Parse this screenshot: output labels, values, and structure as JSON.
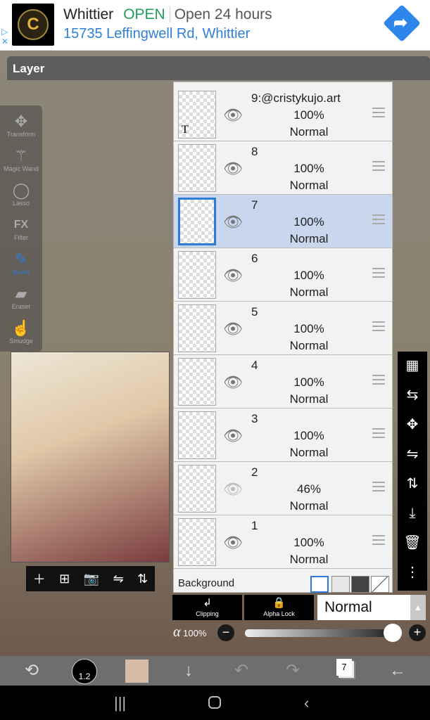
{
  "ad": {
    "business": "Whittier",
    "status": "OPEN",
    "hours": "Open 24 hours",
    "address": "15735 Leffingwell Rd, Whittier",
    "logo_letter": "C",
    "adchoices_icon": "ad-choices-icon",
    "close_icon": "close-icon"
  },
  "layer_panel": {
    "title": "Layer",
    "layers": [
      {
        "name": "9:@cristykujo.art",
        "opacity": "100%",
        "mode": "Normal",
        "visible": true,
        "text_layer_mark": "T"
      },
      {
        "name": "8",
        "opacity": "100%",
        "mode": "Normal",
        "visible": true
      },
      {
        "name": "7",
        "opacity": "100%",
        "mode": "Normal",
        "visible": true,
        "selected": true
      },
      {
        "name": "6",
        "opacity": "100%",
        "mode": "Normal",
        "visible": true
      },
      {
        "name": "5",
        "opacity": "100%",
        "mode": "Normal",
        "visible": true
      },
      {
        "name": "4",
        "opacity": "100%",
        "mode": "Normal",
        "visible": true
      },
      {
        "name": "3",
        "opacity": "100%",
        "mode": "Normal",
        "visible": true
      },
      {
        "name": "2",
        "opacity": "46%",
        "mode": "Normal",
        "visible": false
      },
      {
        "name": "1",
        "opacity": "100%",
        "mode": "Normal",
        "visible": true
      }
    ],
    "background_label": "Background",
    "clipping": "Clipping",
    "alpha_lock": "Alpha Lock",
    "blend_mode": "Normal",
    "alpha_symbol": "α",
    "opacity": "100%",
    "opacity_value": 100
  },
  "tools": [
    "Transform",
    "Magic Wand",
    "Lasso",
    "Filter",
    "Brush",
    "Eraser",
    "Smudge"
  ],
  "active_tool": "Brush",
  "accent": "#2f7ad6",
  "bottom": {
    "brush_size": "1.2",
    "color": "#d7bca8",
    "layer_count": "7"
  }
}
